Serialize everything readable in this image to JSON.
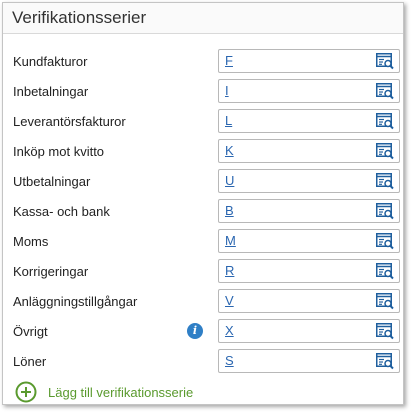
{
  "panel": {
    "title": "Verifikationsserier"
  },
  "rows": [
    {
      "label": "Kundfakturor",
      "value": "F",
      "info": false
    },
    {
      "label": "Inbetalningar",
      "value": "I",
      "info": false
    },
    {
      "label": "Leverantörsfakturor",
      "value": "L",
      "info": false
    },
    {
      "label": "Inköp mot kvitto",
      "value": "K",
      "info": false
    },
    {
      "label": "Utbetalningar",
      "value": "U",
      "info": false
    },
    {
      "label": "Kassa- och bank",
      "value": "B",
      "info": false
    },
    {
      "label": "Moms",
      "value": "M",
      "info": false
    },
    {
      "label": "Korrigeringar",
      "value": "R",
      "info": false
    },
    {
      "label": "Anläggningstillgångar",
      "value": "V",
      "info": false
    },
    {
      "label": "Övrigt",
      "value": "X",
      "info": true
    },
    {
      "label": "Löner",
      "value": "S",
      "info": false
    }
  ],
  "info_icon_glyph": "i",
  "add_action": {
    "label": "Lägg till verifikationsserie"
  },
  "icons": {
    "lookup": "lookup-list-icon",
    "info": "info-icon",
    "add": "plus-circle-icon"
  },
  "colors": {
    "link_value": "#2a66b0",
    "icon_blue": "#1f5f9e",
    "info_blue": "#2f7fc6",
    "add_green": "#5a9a2e"
  }
}
